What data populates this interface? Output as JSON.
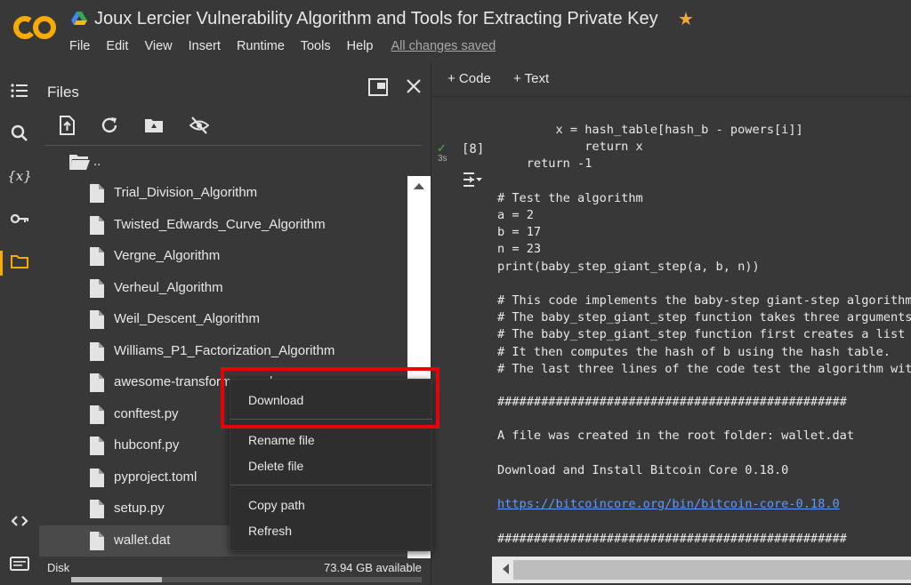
{
  "app": {
    "title": "Joux Lercier Vulnerability Algorithm and Tools for Extracting Private Key",
    "menu": [
      "File",
      "Edit",
      "View",
      "Insert",
      "Runtime",
      "Tools",
      "Help"
    ],
    "save_status": "All changes saved"
  },
  "files_panel": {
    "title": "Files",
    "parent_dir": "..",
    "files": [
      "Trial_Division_Algorithm",
      "Twisted_Edwards_Curve_Algorithm",
      "Vergne_Algorithm",
      "Verheul_Algorithm",
      "Weil_Descent_Algorithm",
      "Williams_P1_Factorization_Algorithm",
      "awesome-transformers.md",
      "conftest.py",
      "hubconf.py",
      "pyproject.toml",
      "setup.py",
      "wallet.dat"
    ],
    "disk_label": "Disk",
    "disk_available": "73.94 GB available",
    "disk_used_fraction": 0.26
  },
  "context_menu": {
    "items": [
      "Download",
      "Rename file",
      "Delete file",
      "Copy path",
      "Refresh"
    ]
  },
  "toolbar": {
    "add_code": "+ Code",
    "add_text": "+ Text"
  },
  "cell": {
    "execution_count": "[8]",
    "status_check": "✓",
    "exec_time": "3s",
    "code": "        x = hash_table[hash_b - powers[i]]\n            return x\n    return -1\n\n# Test the algorithm\na = 2\nb = 17\nn = 23\nprint(baby_step_giant_step(a, b, n))\n\n# This code implements the baby-step giant-step algorithm\n# The baby_step_giant_step function takes three arguments\n# The baby_step_giant_step function first creates a list\n# It then computes the hash of b using the hash table.\n# The last three lines of the code test the algorithm with",
    "output_lines": [
      "################################################",
      "",
      "A file was created in the root folder: wallet.dat",
      "",
      "Download and Install Bitcoin Core 0.18.0",
      ""
    ],
    "output_link": "https://bitcoincore.org/bin/bitcoin-core-0.18.0",
    "output_tail": "\n\n################################################"
  },
  "colors": {
    "background": "#383838",
    "accent": "#f9ab00",
    "highlight_box": "#e8000b",
    "link": "#5c9bff"
  }
}
